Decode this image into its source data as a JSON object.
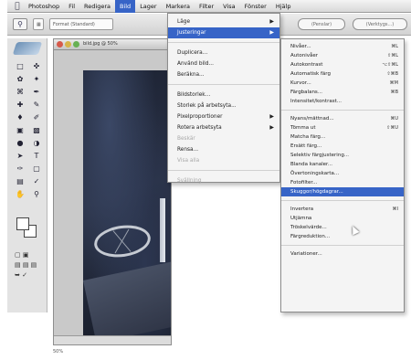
{
  "menubar": {
    "items": [
      "Photoshop",
      "Fil",
      "Redigera",
      "Bild",
      "Lager",
      "Markera",
      "Filter",
      "Visa",
      "Fönster",
      "Hjälp"
    ],
    "active_index": 3
  },
  "optionsbar": {
    "chip_1": "Format (Standard)",
    "chip_2": "",
    "right_1": "(Penslar)",
    "right_2": "(Verktygs...)"
  },
  "document": {
    "title": "bild.jpg @ 50%"
  },
  "image_menu": {
    "items": [
      {
        "label": "Läge",
        "arrow": true
      },
      {
        "label": "Justeringar",
        "arrow": true,
        "selected": true
      },
      {
        "sep": true
      },
      {
        "label": "Duplicera..."
      },
      {
        "label": "Använd bild..."
      },
      {
        "label": "Beräkna..."
      },
      {
        "sep": true
      },
      {
        "label": "Bildstorlek..."
      },
      {
        "label": "Storlek på arbetsyta..."
      },
      {
        "label": "Pixelproportioner",
        "arrow": true
      },
      {
        "label": "Rotera arbetsyta",
        "arrow": true
      },
      {
        "label": "Beskär",
        "disabled": true
      },
      {
        "label": "Rensa..."
      },
      {
        "label": "Visa alla",
        "disabled": true
      },
      {
        "sep": true
      },
      {
        "label": "Svällning",
        "disabled": true
      }
    ]
  },
  "adjust_menu": {
    "items": [
      {
        "label": "Nivåer...",
        "sc": "⌘L"
      },
      {
        "label": "Autonivåer",
        "sc": "⇧⌘L"
      },
      {
        "label": "Autokontrast",
        "sc": "⌥⇧⌘L"
      },
      {
        "label": "Automatisk färg",
        "sc": "⇧⌘B"
      },
      {
        "label": "Kurvor...",
        "sc": "⌘M"
      },
      {
        "label": "Färgbalans...",
        "sc": "⌘B"
      },
      {
        "label": "Intensitet/kontrast..."
      },
      {
        "sep": true
      },
      {
        "label": "Nyans/mättnad...",
        "sc": "⌘U"
      },
      {
        "label": "Tömma ut",
        "sc": "⇧⌘U"
      },
      {
        "label": "Matcha färg..."
      },
      {
        "label": "Ersätt färg..."
      },
      {
        "label": "Selektiv färgjustering..."
      },
      {
        "label": "Blanda kanaler..."
      },
      {
        "label": "Övertoningskarta..."
      },
      {
        "label": "Fotofilter..."
      },
      {
        "label": "Skuggor/högdagrar...",
        "highlight": true
      },
      {
        "sep": true
      },
      {
        "label": "Invertera",
        "sc": "⌘I"
      },
      {
        "label": "Utjämna"
      },
      {
        "label": "Tröskelvärde..."
      },
      {
        "label": "Färgreduktion..."
      },
      {
        "sep": true
      },
      {
        "label": "Variationer..."
      }
    ]
  },
  "status": {
    "zoom": "50%"
  },
  "colors": {
    "highlight": "#3764c7",
    "menu_bg": "#f4f4f4"
  }
}
